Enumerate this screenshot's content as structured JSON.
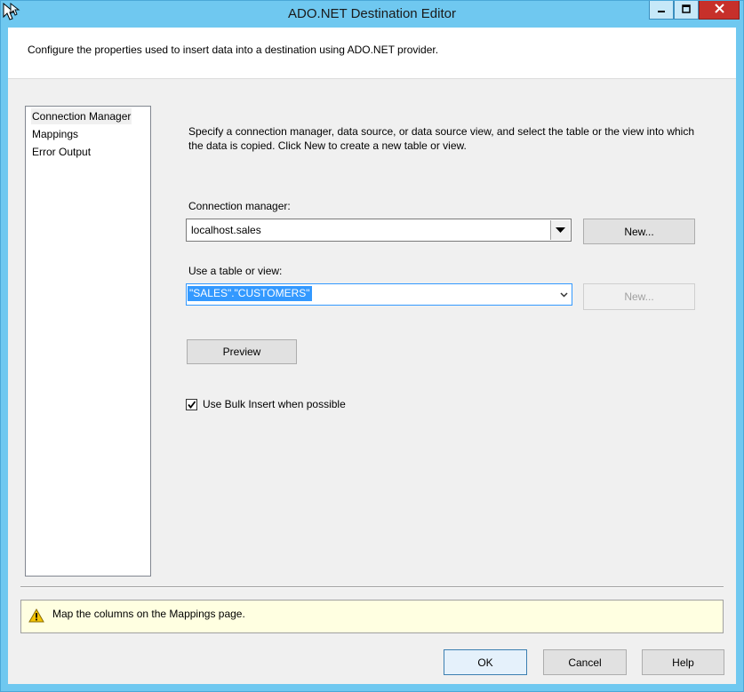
{
  "window": {
    "title": "ADO.NET Destination Editor",
    "controls": {
      "minimize": "minimize",
      "maximize": "maximize",
      "close": "close"
    }
  },
  "header": {
    "description": "Configure the properties used to insert data into a destination using ADO.NET provider."
  },
  "nav": {
    "items": [
      {
        "label": "Connection Manager",
        "selected": true
      },
      {
        "label": "Mappings",
        "selected": false
      },
      {
        "label": "Error Output",
        "selected": false
      }
    ]
  },
  "main": {
    "instruction": "Specify a connection manager, data source, or data source view, and select the table or the view into which the data is copied. Click New to create a new table or view.",
    "connection_manager": {
      "label": "Connection manager:",
      "value": "localhost.sales",
      "new_button": "New..."
    },
    "table_or_view": {
      "label": "Use a table or view:",
      "value": "\"SALES\".\"CUSTOMERS\"",
      "new_button": "New..."
    },
    "preview_button": "Preview",
    "bulk_insert": {
      "label": "Use Bulk Insert when possible",
      "checked": true
    }
  },
  "status": {
    "message": "Map the columns on the Mappings page."
  },
  "footer": {
    "ok": "OK",
    "cancel": "Cancel",
    "help": "Help"
  },
  "colors": {
    "title_bar": "#6fc8f0",
    "close_button": "#c7302a",
    "selection": "#3399ff",
    "warning_bg": "#ffffe1",
    "warning_icon": "#f5c400"
  }
}
